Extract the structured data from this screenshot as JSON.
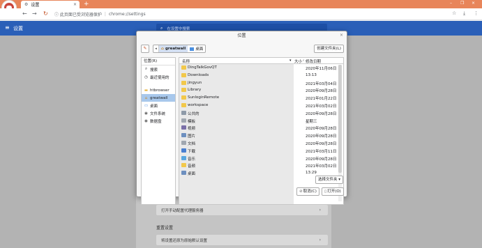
{
  "browser": {
    "tab_title": "设置",
    "tab_icon": "gear-icon",
    "new_tab": "+",
    "close_tab": "×",
    "window_controls": [
      "–",
      "❐",
      "×"
    ],
    "secure_label": "ⓘ 此页面已受浏览器保护",
    "secure_text": "ⓘ 此页面已受浏览器保护",
    "url": "chrome://settings",
    "url_sep": "|"
  },
  "settings": {
    "menu_icon": "≡",
    "title": "设置",
    "search_icon": "⌕",
    "search_placeholder": "在设置中搜索",
    "rows": [
      {
        "label": "打开手动配置代理服务器",
        "chevron": "›"
      },
      {
        "label": "将设置还原为原始默认设置",
        "chevron": "›"
      }
    ],
    "section_reset": "重置设置"
  },
  "dialog": {
    "title": "位置",
    "close": "×",
    "edit_icon": "✎",
    "back_arrow": "◂",
    "crumbs": [
      {
        "label": "greatwall",
        "icon": "home-icon"
      },
      {
        "label": "桌面",
        "icon": "desktop-icon"
      }
    ],
    "mkdir": "创建文件夹(L)",
    "places_header": "位置(R)",
    "places": [
      {
        "label": "搜索",
        "icon": "⌕"
      },
      {
        "label": "最近使用的",
        "icon": "◷"
      },
      {
        "label": "htbrowser",
        "icon": "▬"
      },
      {
        "label": "greatwall",
        "icon": "⌂"
      },
      {
        "label": "桌面",
        "icon": "▭"
      },
      {
        "label": "文件系统",
        "icon": "◉"
      },
      {
        "label": "数据盘",
        "icon": "◉"
      }
    ],
    "columns": {
      "name": "名称",
      "size": "大小",
      "modified": "修改日期"
    },
    "files": [
      {
        "name": "DingTalkGovQT",
        "date": "2020年11月06日",
        "kind": "folder"
      },
      {
        "name": "Downloads",
        "date": "13:13",
        "kind": "folder"
      },
      {
        "name": "jingyun",
        "date": "2021年03月04日",
        "kind": "folder"
      },
      {
        "name": "Library",
        "date": "2020年09月28日",
        "kind": "folder"
      },
      {
        "name": "SunloginRemote",
        "date": "2021年01月22日",
        "kind": "folder"
      },
      {
        "name": "workspace",
        "date": "2021年03月02日",
        "kind": "folder"
      },
      {
        "name": "公共的",
        "date": "2020年09月28日",
        "kind": "pub"
      },
      {
        "name": "模板",
        "date": "星期三",
        "kind": "doc"
      },
      {
        "name": "视频",
        "date": "2020年09月28日",
        "kind": "video"
      },
      {
        "name": "图片",
        "date": "2020年09月28日",
        "kind": "sys"
      },
      {
        "name": "文档",
        "date": "2020年09月28日",
        "kind": "doc"
      },
      {
        "name": "下载",
        "date": "2021年03月11日",
        "kind": "down"
      },
      {
        "name": "音乐",
        "date": "2020年09月28日",
        "kind": "music"
      },
      {
        "name": "音频",
        "date": "2021年03月02日",
        "kind": "folder"
      },
      {
        "name": "桌面",
        "date": "13:29",
        "kind": "sys"
      }
    ],
    "filetype": "选择文件夹 ▾",
    "cancel": "取消(C)",
    "cancel_icon": "⊘",
    "open": "打开(O)",
    "open_icon": "▯"
  }
}
